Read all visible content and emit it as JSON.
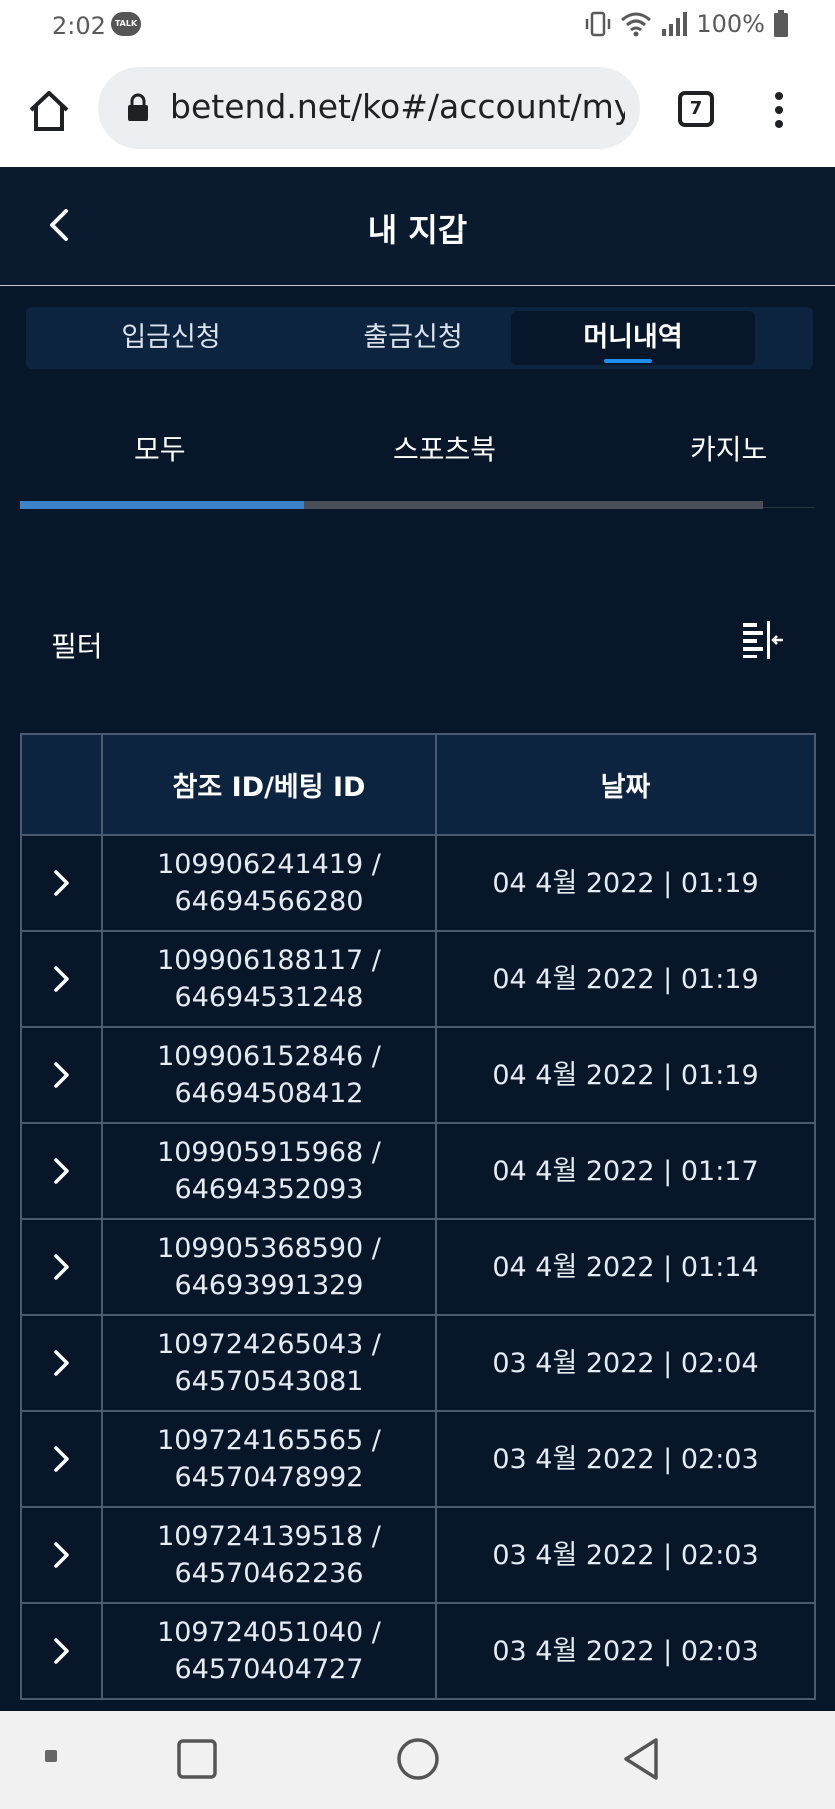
{
  "status_bar": {
    "time": "2:02",
    "talk_badge": "TALK",
    "battery": "100%"
  },
  "browser": {
    "url": "betend.net/ko#/account/my-",
    "tab_count": "7"
  },
  "header": {
    "title": "내 지갑"
  },
  "tabs": [
    {
      "label": "입금신청"
    },
    {
      "label": "출금신청"
    },
    {
      "label": "머니내역",
      "active": true
    }
  ],
  "subtabs": [
    {
      "label": "모두",
      "active": true
    },
    {
      "label": "스포츠북"
    },
    {
      "label": "카지노"
    }
  ],
  "filter": {
    "label": "필터"
  },
  "table": {
    "headers": [
      "",
      "참조 ID/베팅 ID",
      "날짜"
    ],
    "rows": [
      {
        "ref_id": "109906241419 /",
        "bet_id": "64694566280",
        "date": "04 4월 2022 | 01:19"
      },
      {
        "ref_id": "109906188117 /",
        "bet_id": "64694531248",
        "date": "04 4월 2022 | 01:19"
      },
      {
        "ref_id": "109906152846 /",
        "bet_id": "64694508412",
        "date": "04 4월 2022 | 01:19"
      },
      {
        "ref_id": "109905915968 /",
        "bet_id": "64694352093",
        "date": "04 4월 2022 | 01:17"
      },
      {
        "ref_id": "109905368590 /",
        "bet_id": "64693991329",
        "date": "04 4월 2022 | 01:14"
      },
      {
        "ref_id": "109724265043 /",
        "bet_id": "64570543081",
        "date": "03 4월 2022 | 02:04"
      },
      {
        "ref_id": "109724165565 /",
        "bet_id": "64570478992",
        "date": "03 4월 2022 | 02:03"
      },
      {
        "ref_id": "109724139518 /",
        "bet_id": "64570462236",
        "date": "03 4월 2022 | 02:03"
      },
      {
        "ref_id": "109724051040 /",
        "bet_id": "64570404727",
        "date": "03 4월 2022 | 02:03"
      }
    ]
  },
  "colors": {
    "background": "#08162a",
    "header_bg": "#0d2440",
    "accent": "#1f8ef1",
    "subtab_active": "#3c82c8"
  }
}
